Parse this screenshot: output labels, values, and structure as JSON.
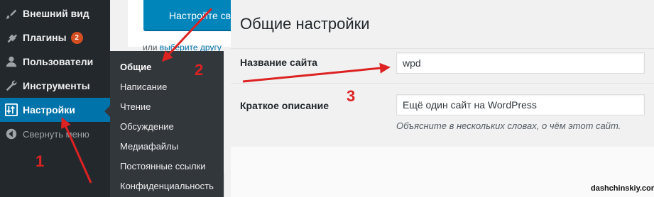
{
  "menu": {
    "items": [
      {
        "label": "Внешний вид",
        "icon": "paintbrush-icon"
      },
      {
        "label": "Плагины",
        "icon": "plug-icon",
        "badge": "2"
      },
      {
        "label": "Пользователи",
        "icon": "user-icon"
      },
      {
        "label": "Инструменты",
        "icon": "wrench-icon"
      },
      {
        "label": "Настройки",
        "icon": "settings-icon",
        "active": true
      },
      {
        "label": "Свернуть меню",
        "icon": "collapse-icon"
      }
    ]
  },
  "submenu": {
    "items": [
      {
        "label": "Общие",
        "current": true
      },
      {
        "label": "Написание"
      },
      {
        "label": "Чтение"
      },
      {
        "label": "Обсуждение"
      },
      {
        "label": "Медиафайлы"
      },
      {
        "label": "Постоянные ссылки"
      },
      {
        "label": "Конфиденциальность"
      }
    ]
  },
  "background": {
    "cta_label": "Настройте св",
    "link_prefix": "или ",
    "link_text": "выберите другу"
  },
  "settings": {
    "title": "Общие настройки",
    "site_title_label": "Название сайта",
    "site_title_value": "wpd",
    "tagline_label": "Краткое описание",
    "tagline_value": "Ещё один сайт на WordPress",
    "tagline_description": "Объясните в нескольких словах, о чём этот сайт."
  },
  "annotations": {
    "step1": "1",
    "step2": "2",
    "step3": "3",
    "color": "#dd2222"
  },
  "watermark": "dashchinskiy.com"
}
